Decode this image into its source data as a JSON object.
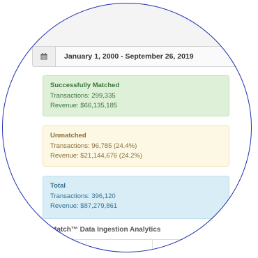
{
  "date_range": {
    "icon": "calendar-icon",
    "value": "January 1, 2000 - September 26, 2019"
  },
  "summary": {
    "matched": {
      "title": "Successfully Matched",
      "transactions": "Transactions: 299,335",
      "revenue": "Revenue: $66,135,185"
    },
    "unmatched": {
      "title": "Unmatched",
      "transactions": "Transactions: 96,785 (24.4%)",
      "revenue": "Revenue: $21,144,676 (24.2%)"
    },
    "total": {
      "title": "Total",
      "transactions": "Transactions: 396,120",
      "revenue": "Revenue: $87,279,861"
    }
  },
  "section_title": "Match™ Data Ingestion Analytics",
  "colors": {
    "success_bg": "#dff0d8",
    "warning_bg": "#fcf8e3",
    "info_bg": "#d9edf7",
    "ring": "#1d2fb0"
  }
}
